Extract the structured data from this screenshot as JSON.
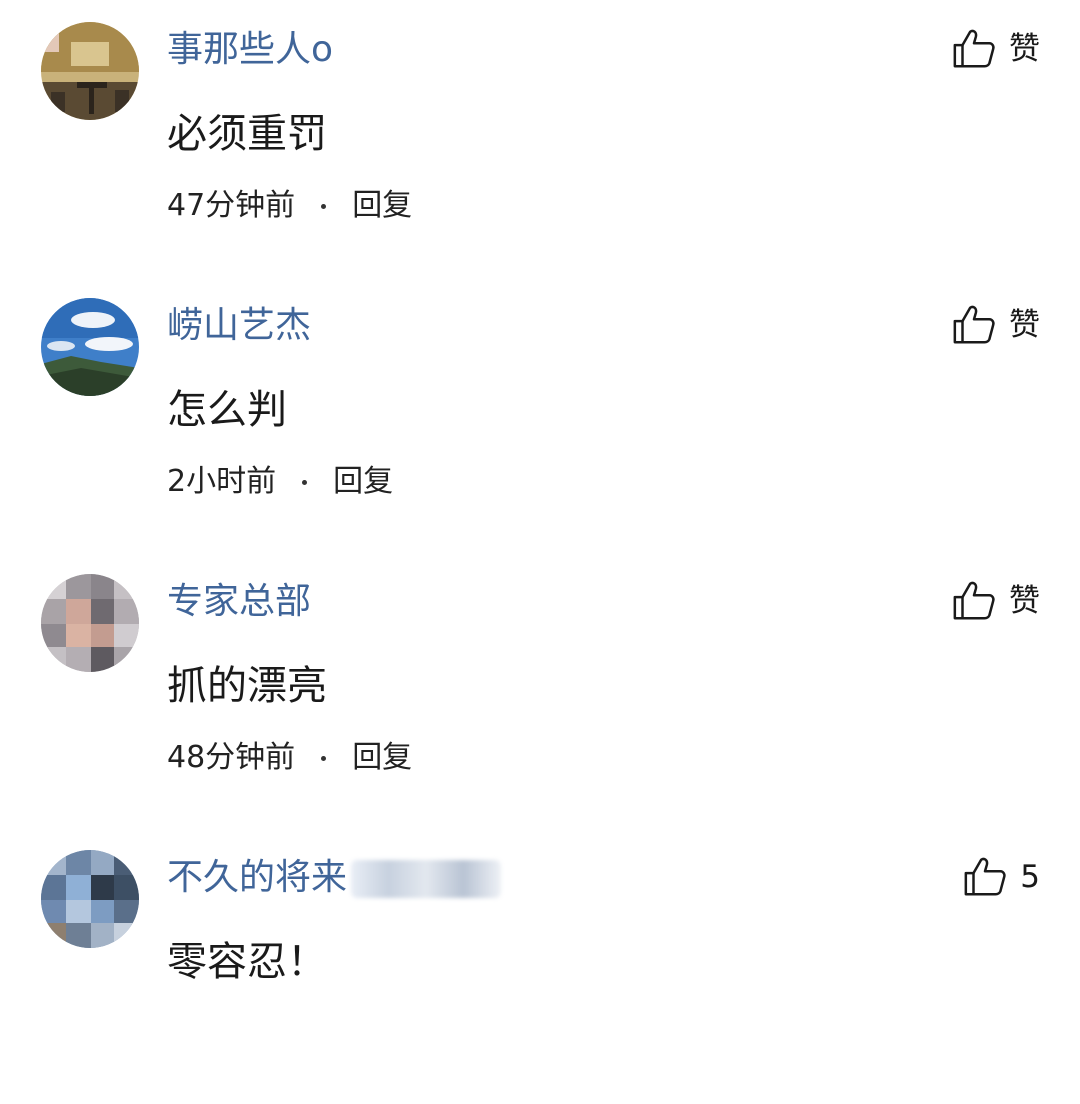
{
  "comments": [
    {
      "username": "事那些人o",
      "content": "必须重罚",
      "time": "47分钟前",
      "reply_label": "回复",
      "like_label": "赞",
      "avatar_icon": "cafe-photo-avatar"
    },
    {
      "username": "崂山艺杰",
      "content": "怎么判",
      "time": "2小时前",
      "reply_label": "回复",
      "like_label": "赞",
      "avatar_icon": "sky-landscape-avatar"
    },
    {
      "username": "专家总部",
      "content": "抓的漂亮",
      "time": "48分钟前",
      "reply_label": "回复",
      "like_label": "赞",
      "avatar_icon": "pixelated-face-avatar"
    },
    {
      "username": "不久的将来",
      "content": "零容忍！",
      "like_label": "5",
      "avatar_icon": "pixelated-avatar"
    }
  ],
  "colors": {
    "username": "#406599",
    "text": "#1a1a1a",
    "background": "#ffffff"
  }
}
